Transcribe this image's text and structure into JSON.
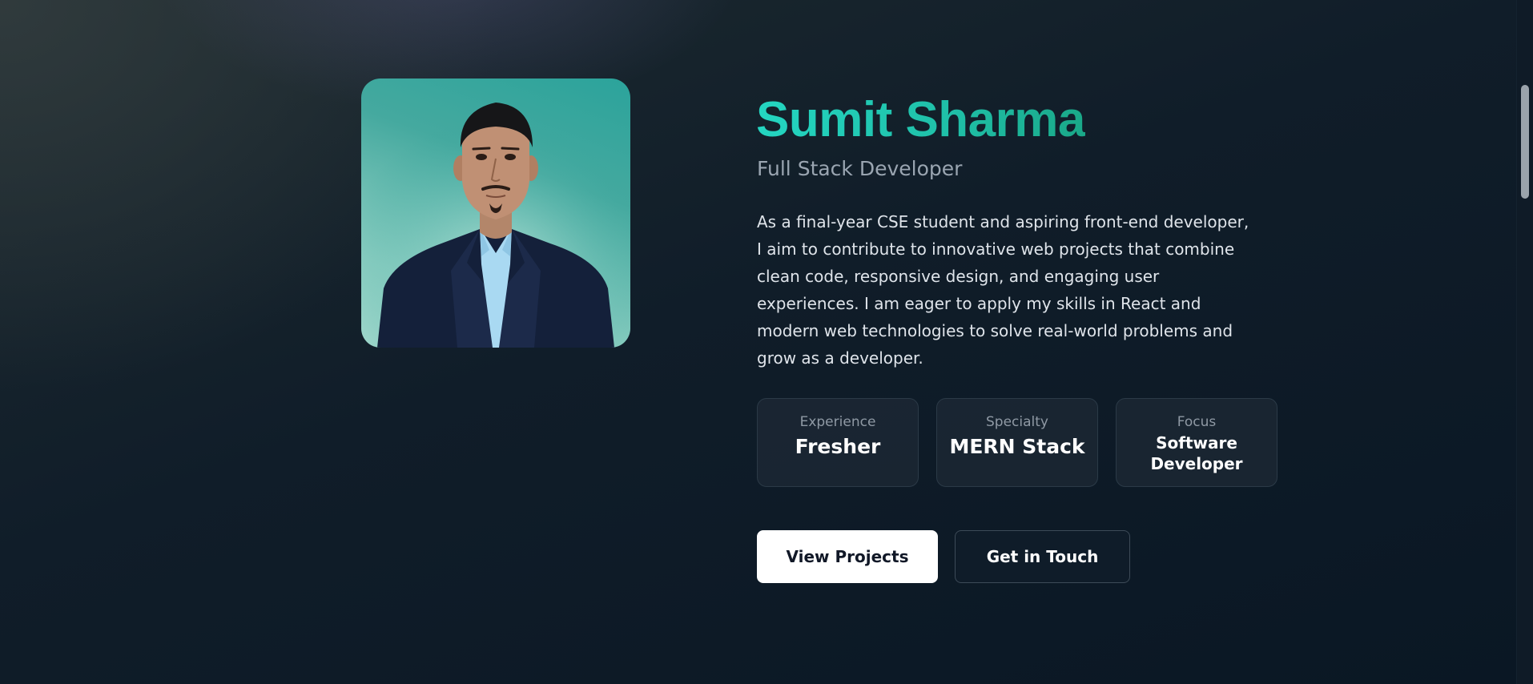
{
  "profile": {
    "name": "Sumit Sharma",
    "title": "Full Stack Developer",
    "bio_lines": [
      "As a final-year CSE student and aspiring front-end developer,",
      "I aim to contribute to innovative web projects that combine",
      "clean code, responsive design, and engaging user",
      "experiences. I am eager to apply my skills in React and",
      "modern web technologies to solve real-world problems and",
      "grow as a developer."
    ]
  },
  "stats": [
    {
      "label": "Experience",
      "value": "Fresher"
    },
    {
      "label": "Specialty",
      "value": "MERN Stack"
    },
    {
      "label": "Focus",
      "value_lines": [
        "Software",
        "Developer"
      ]
    }
  ],
  "actions": {
    "primary_label": "View Projects",
    "secondary_label": "Get in Touch"
  },
  "colors": {
    "name_gradient_start": "#24d6c2",
    "name_gradient_end": "#1aa888",
    "background": "#0d1a26",
    "primary_button_bg": "#ffffff",
    "card_border": "#2b3a47"
  }
}
